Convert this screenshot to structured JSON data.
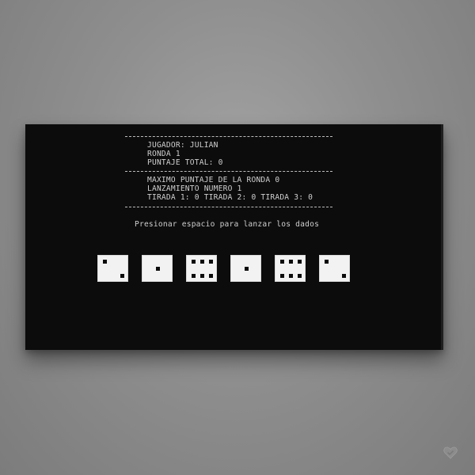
{
  "header": {
    "player": "JUGADOR: JULIAN",
    "round": "RONDA 1",
    "total_score": "PUNTAJE TOTAL: 0"
  },
  "round_info": {
    "max_score": "MAXIMO PUNTAJE DE LA RONDA 0",
    "throw_number": "LANZAMIENTO NUMERO 1",
    "throws": "TIRADA 1: 0 TIRADA 2: 0 TIRADA 3: 0"
  },
  "prompt": "Presionar espacio para lanzar los dados",
  "dice": [
    2,
    1,
    6,
    1,
    6,
    2
  ],
  "colors": {
    "console_bg": "#0c0c0c",
    "text": "#cfcfcf",
    "die_face": "#f2f2f2",
    "pip": "#0c0c0c"
  },
  "icons": {
    "corner": "heart-icon"
  }
}
